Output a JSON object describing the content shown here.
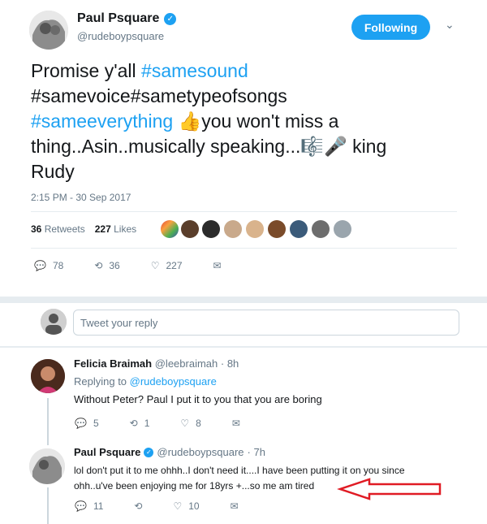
{
  "author": {
    "name": "Paul Psquare",
    "handle": "@rudeboypsquare"
  },
  "follow_button": "Following",
  "tweet": {
    "l1_plain": "Promise y'all  ",
    "l1_tag": "#samesound",
    "l2_plain": "#samevoice#sametypeofsongs",
    "l3_tag": "#sameeverything",
    "l3_plain": "you won't miss a",
    "l4_plain": "thing..Asin..musically speaking...",
    "l4_after": "king",
    "l5_plain": "Rudy"
  },
  "timestamp": "2:15 PM - 30 Sep 2017",
  "stats": {
    "retweets_count": "36",
    "retweets_label": "Retweets",
    "likes_count": "227",
    "likes_label": "Likes"
  },
  "actions": {
    "replies": "78",
    "retweets": "36",
    "likes": "227"
  },
  "reply_box": {
    "placeholder": "Tweet your reply"
  },
  "replies": [
    {
      "name": "Felicia Braimah",
      "handle": "@leebraimah",
      "time": "· 8h",
      "replying_prefix": "Replying to ",
      "replying_to": "@rudeboypsquare",
      "text": "Without Peter? Paul I put it to you that you are boring",
      "counts": {
        "replies": "5",
        "retweets": "1",
        "likes": "8"
      }
    },
    {
      "name": "Paul Psquare",
      "handle": "@rudeboypsquare",
      "time": "· 7h",
      "text_l1": "lol don't put it to me ohhh..I don't need it....I have been putting it on you since",
      "text_l2": "ohh..u've been enjoying me for 18yrs +...so me am tired",
      "counts": {
        "replies": "11",
        "likes": "10"
      }
    }
  ],
  "colors": {
    "accent": "#1da1f2",
    "annotation_arrow": "#e01b24",
    "thumb": "#f5a623"
  }
}
